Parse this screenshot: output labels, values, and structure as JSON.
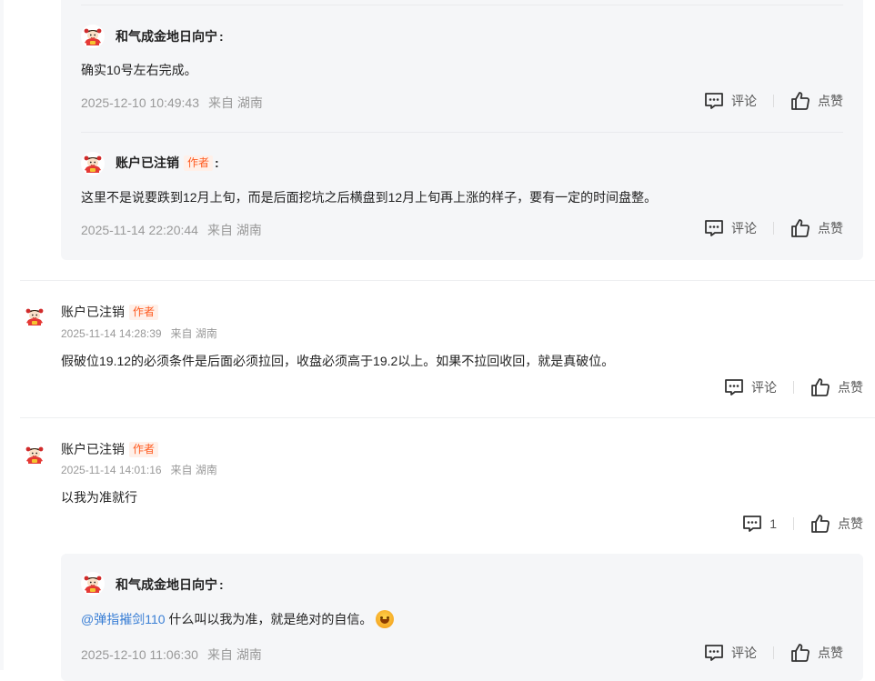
{
  "labels": {
    "comment": "评论",
    "like": "点赞",
    "author_tag": "作者"
  },
  "block1": {
    "reply1": {
      "user": "和气成金地日向宁",
      "text": "确实10号左右完成。",
      "time": "2025-12-10 10:49:43",
      "location": "来自 湖南"
    },
    "reply2": {
      "user": "账户已注销",
      "text": "这里不是说要跌到12月上旬，而是后面挖坑之后横盘到12月上旬再上涨的样子，要有一定的时间盘整。",
      "time": "2025-11-14 22:20:44",
      "location": "来自 湖南"
    }
  },
  "comment1": {
    "user": "账户已注销",
    "time": "2025-11-14 14:28:39",
    "location": "来自 湖南",
    "text": "假破位19.12的必须条件是后面必须拉回，收盘必须高于19.2以上。如果不拉回收回，就是真破位。"
  },
  "comment2": {
    "user": "账户已注销",
    "time": "2025-11-14 14:01:16",
    "location": "来自 湖南",
    "text": "以我为准就行",
    "reply_count": "1"
  },
  "block2": {
    "reply1": {
      "user": "和气成金地日向宁",
      "mention": "@弹指摧剑110",
      "text": " 什么叫以我为准，就是绝对的自信。",
      "time": "2025-12-10 11:06:30",
      "location": "来自 湖南"
    }
  }
}
